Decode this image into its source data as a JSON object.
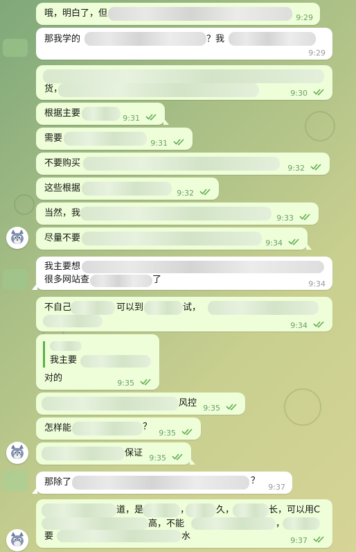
{
  "messages": [
    {
      "text": "哦，明白了，但",
      "time": "9:29"
    },
    {
      "text_a": "那我学的",
      "text_b": "？我",
      "time": "9:29"
    },
    {
      "text": "货，",
      "time": "9:30"
    },
    {
      "text": "根据主要",
      "time": "9:31"
    },
    {
      "text": "需要",
      "time": "9:31"
    },
    {
      "text": "不要购买",
      "time": "9:32"
    },
    {
      "text": "这些根据",
      "time": "9:32"
    },
    {
      "text": "当然，我",
      "time": "9:33"
    },
    {
      "text": "尽量不要",
      "time": "9:34"
    },
    {
      "line1": "我主要想",
      "line2_a": "很多网站查",
      "line2_b": "了",
      "time": "9:34"
    },
    {
      "text_a": "不自己",
      "text_b": "可以到",
      "text_c": "试，",
      "time": "9:34"
    },
    {
      "quote": "我主要",
      "text": "对的",
      "time": "9:35"
    },
    {
      "text": "风控",
      "time": "9:35"
    },
    {
      "text_a": "怎样能",
      "text_b": "？",
      "time": "9:35"
    },
    {
      "text": "保证",
      "time": "9:35"
    },
    {
      "text_a": "那除了",
      "text_b": "？",
      "time": "9:37"
    },
    {
      "l1_a": "道，是",
      "l1_b": "，",
      "l1_c": "久，",
      "l1_d": "长，可以用C",
      "l2_a": "高，不能",
      "l2_b": "，",
      "l3_a": "要",
      "l3_b": "水",
      "time": "9:37"
    }
  ],
  "colors": {
    "outgoing": "#eefed9",
    "incoming": "#ffffff",
    "check": "#5fad4e"
  }
}
